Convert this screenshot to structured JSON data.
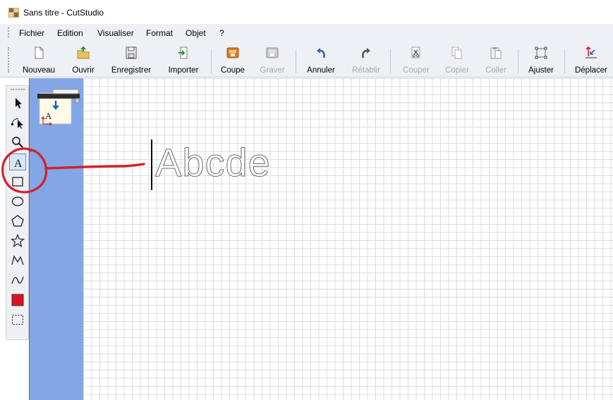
{
  "window": {
    "title": "Sans titre - CutStudio"
  },
  "menu": [
    "Fichier",
    "Edition",
    "Visualiser",
    "Format",
    "Objet",
    "?"
  ],
  "toolbar": [
    {
      "label": "Nouveau",
      "icon": "new-file-icon",
      "enabled": true
    },
    {
      "label": "Ouvrir",
      "icon": "open-folder-icon",
      "enabled": true
    },
    {
      "label": "Enregistrer",
      "icon": "save-icon",
      "enabled": true
    },
    {
      "label": "Importer",
      "icon": "import-icon",
      "enabled": true
    },
    {
      "label": "Coupe",
      "icon": "cut-to-device-icon",
      "enabled": true
    },
    {
      "label": "Graver",
      "icon": "engrave-icon",
      "enabled": false
    },
    {
      "label": "Annuler",
      "icon": "undo-icon",
      "enabled": true
    },
    {
      "label": "Rétablir",
      "icon": "redo-icon",
      "enabled": false
    },
    {
      "label": "Couper",
      "icon": "scissors-icon",
      "enabled": false
    },
    {
      "label": "Copier",
      "icon": "copy-icon",
      "enabled": false
    },
    {
      "label": "Coller",
      "icon": "paste-icon",
      "enabled": false
    },
    {
      "label": "Ajuster",
      "icon": "fit-icon",
      "enabled": true
    },
    {
      "label": "Déplacer",
      "icon": "move-icon",
      "enabled": true
    }
  ],
  "tools": [
    {
      "name": "select-arrow-icon"
    },
    {
      "name": "node-edit-icon"
    },
    {
      "name": "zoom-icon"
    },
    {
      "name": "text-tool-icon",
      "glyph": "A",
      "active": true
    },
    {
      "name": "rectangle-icon"
    },
    {
      "name": "ellipse-icon"
    },
    {
      "name": "polygon-icon"
    },
    {
      "name": "star-icon"
    },
    {
      "name": "polyline-icon"
    },
    {
      "name": "curve-icon"
    },
    {
      "name": "fill-color-icon",
      "color": "#e01020"
    },
    {
      "name": "marquee-select-icon"
    }
  ],
  "sheet": {
    "icon": "cutter-sheet-icon",
    "glyph": "A",
    "color": "#83a6e6"
  },
  "canvas": {
    "text": "Abcde"
  },
  "colors": {
    "annotation": "#d42027",
    "chrome": "#eff0f5",
    "grid": "#dcdcdc"
  }
}
